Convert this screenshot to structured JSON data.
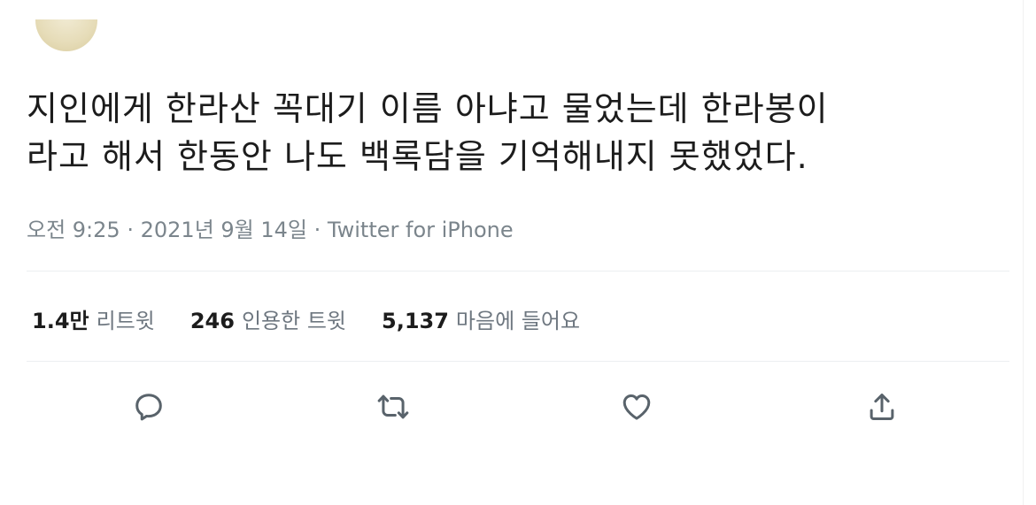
{
  "tweet": {
    "text": "지인에게 한라산 꼭대기 이름 아냐고 물었는데 한라봉이\n라고 해서 한동안 나도 백록담을 기억해내지 못했었다.",
    "time": "오전 9:25",
    "separator": "·",
    "date": "2021년 9월 14일",
    "source": "Twitter for iPhone"
  },
  "stats": {
    "retweets": {
      "count": "1.4만",
      "label": "리트윗"
    },
    "quotes": {
      "count": "246",
      "label": "인용한 트윗"
    },
    "likes": {
      "count": "5,137",
      "label": "마음에 들어요"
    }
  },
  "actions": {
    "reply_icon": "reply-icon",
    "retweet_icon": "retweet-icon",
    "like_icon": "heart-icon",
    "share_icon": "share-icon"
  },
  "colors": {
    "text": "#1c1c1c",
    "muted": "#7b858c",
    "icon": "#59636b",
    "divider": "#eceff1"
  }
}
